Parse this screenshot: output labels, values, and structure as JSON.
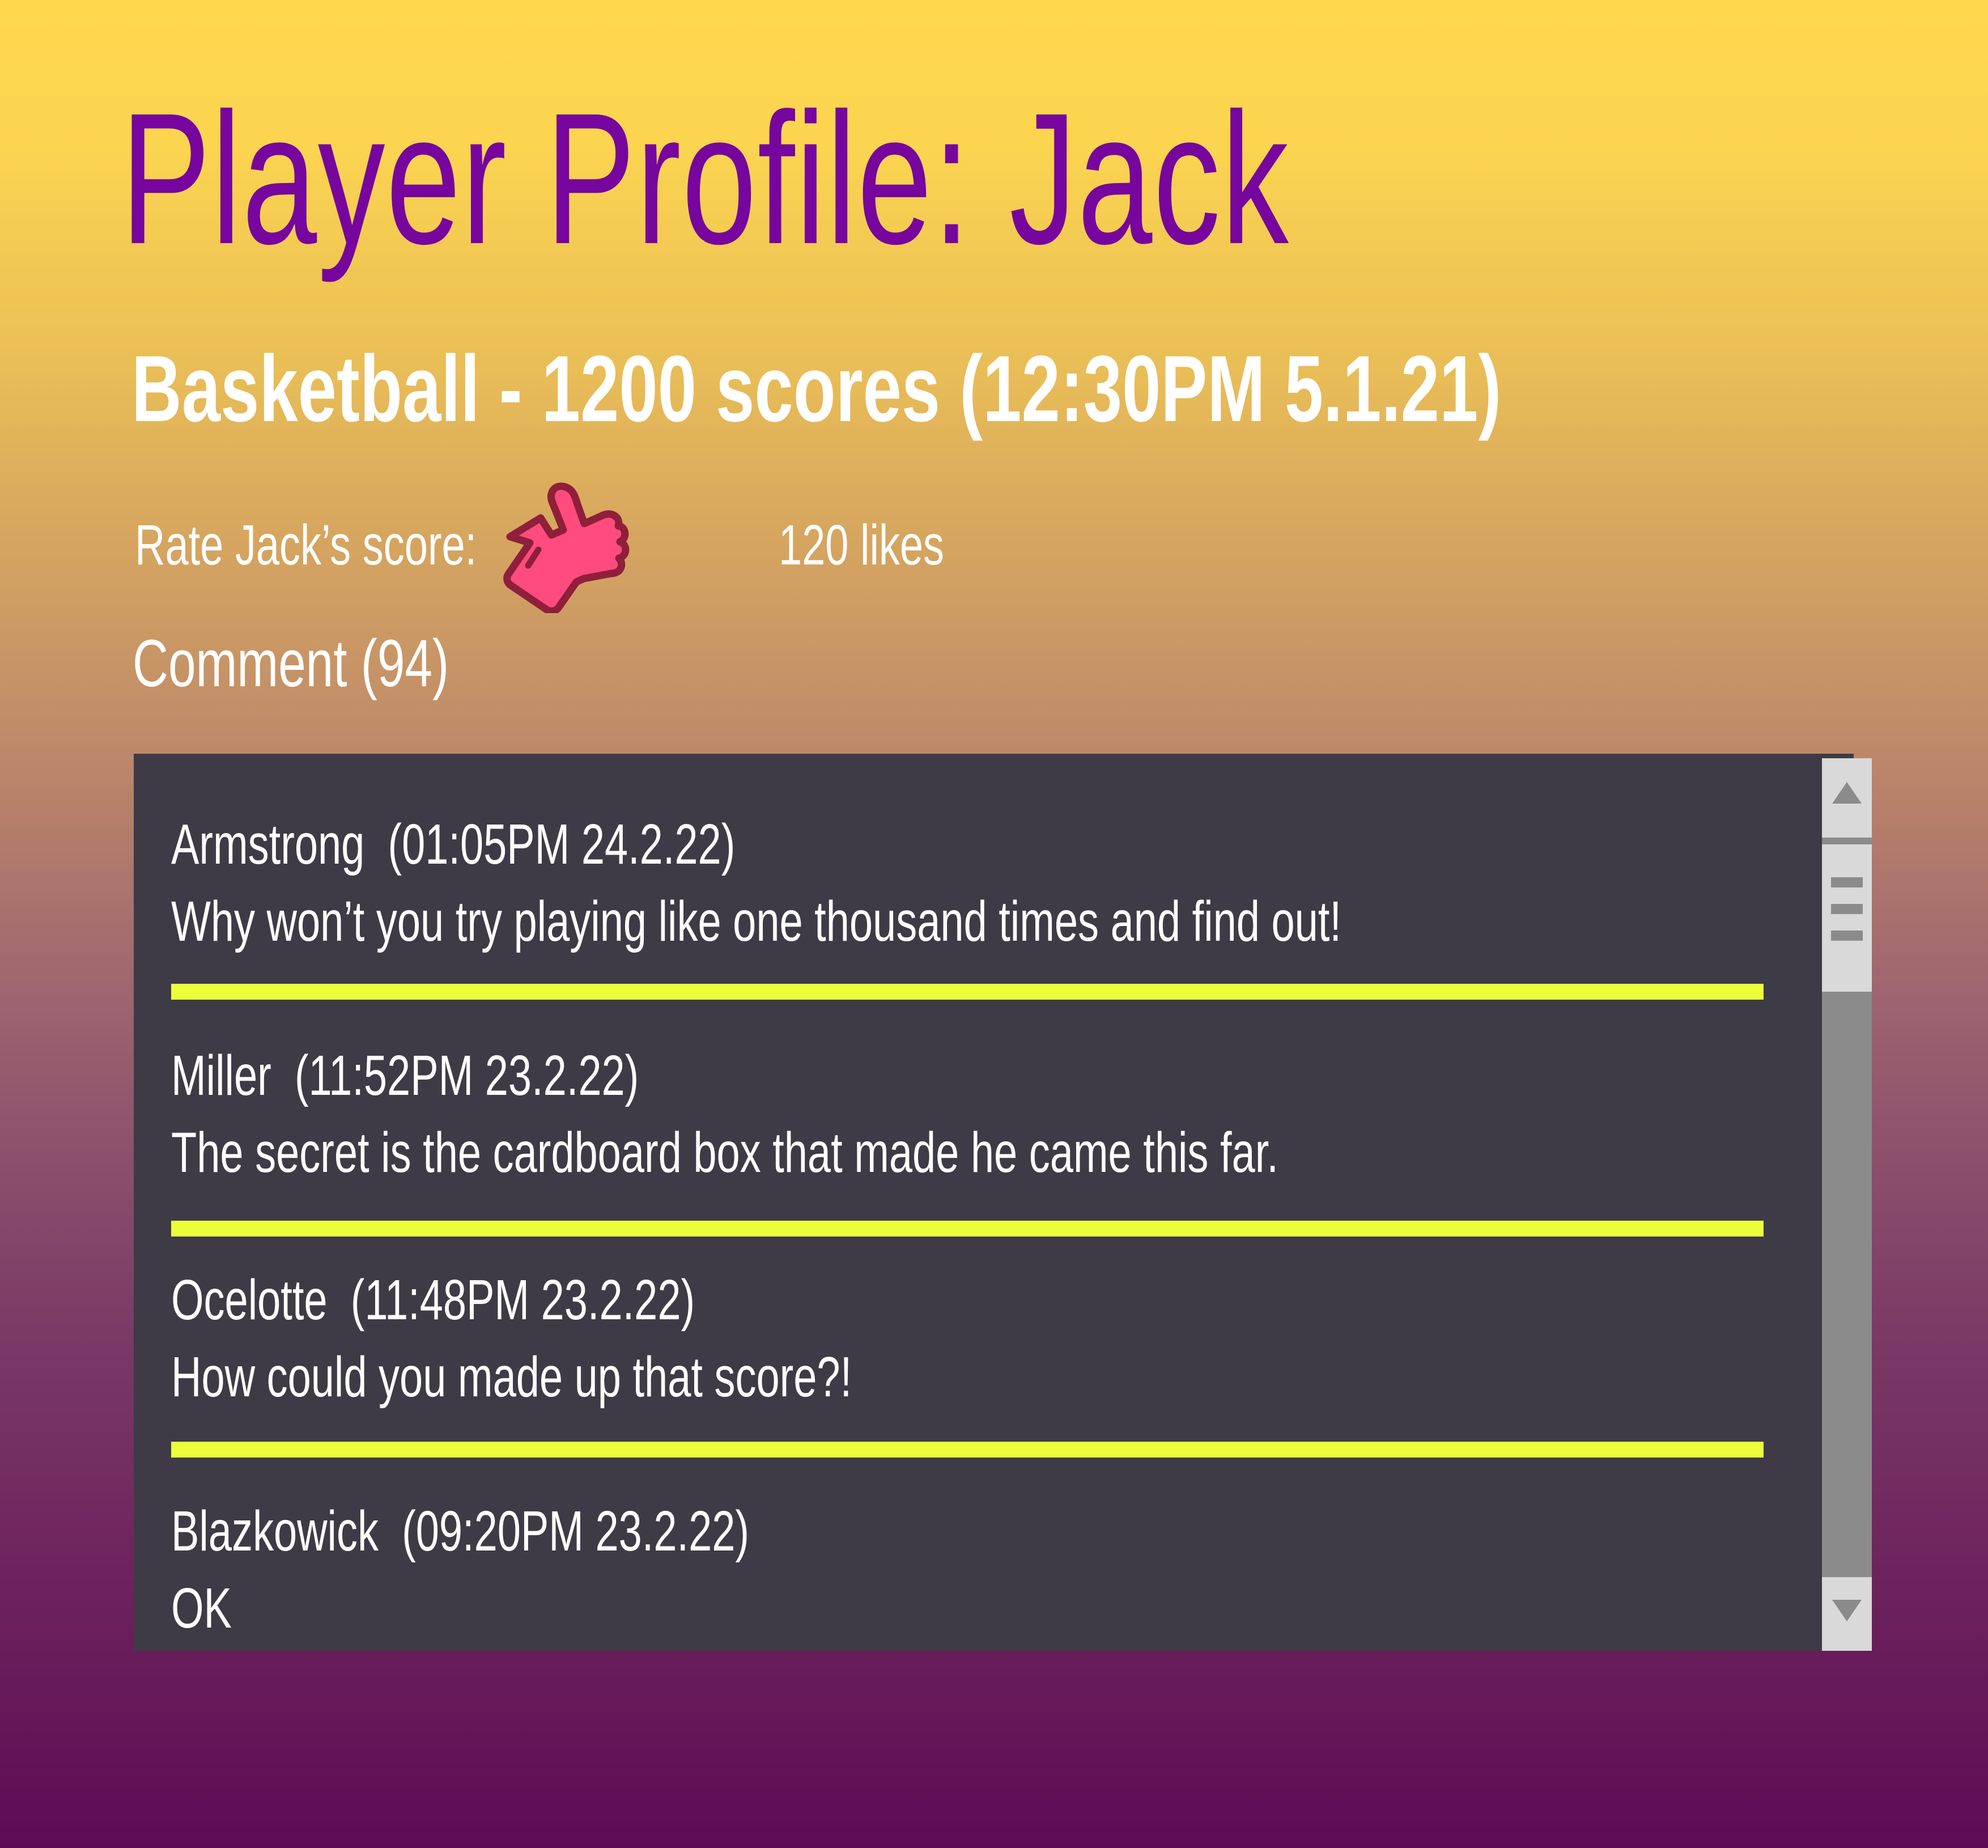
{
  "profile": {
    "title": "Player Profile: Jack",
    "subtitle": "Basketball - 1200 scores (12:30PM 5.1.21)"
  },
  "rating": {
    "label": "Rate Jack’s score:",
    "likes": "120 likes",
    "icon": "thumbs-up-icon",
    "icon_color": "#ff4b7d"
  },
  "comments": {
    "heading": "Comment (94)",
    "items": [
      {
        "author": "Armstrong  (01:05PM 24.2.22)",
        "text": "Why won’t you try playing like one thousand times and find out!"
      },
      {
        "author": "Miller  (11:52PM 23.2.22)",
        "text": "The secret is the cardboard box that made he came this far."
      },
      {
        "author": "Ocelotte  (11:48PM 23.2.22)",
        "text": "How could you made up that score?!"
      },
      {
        "author": "Blazkowick  (09:20PM 23.2.22)",
        "text": "OK"
      }
    ]
  },
  "colors": {
    "title": "#76069d",
    "panel": "#3e3b46",
    "divider": "#eaff3a",
    "scrollbar_track": "#8b8b8b",
    "scrollbar_thumb": "#d9d9d9"
  }
}
